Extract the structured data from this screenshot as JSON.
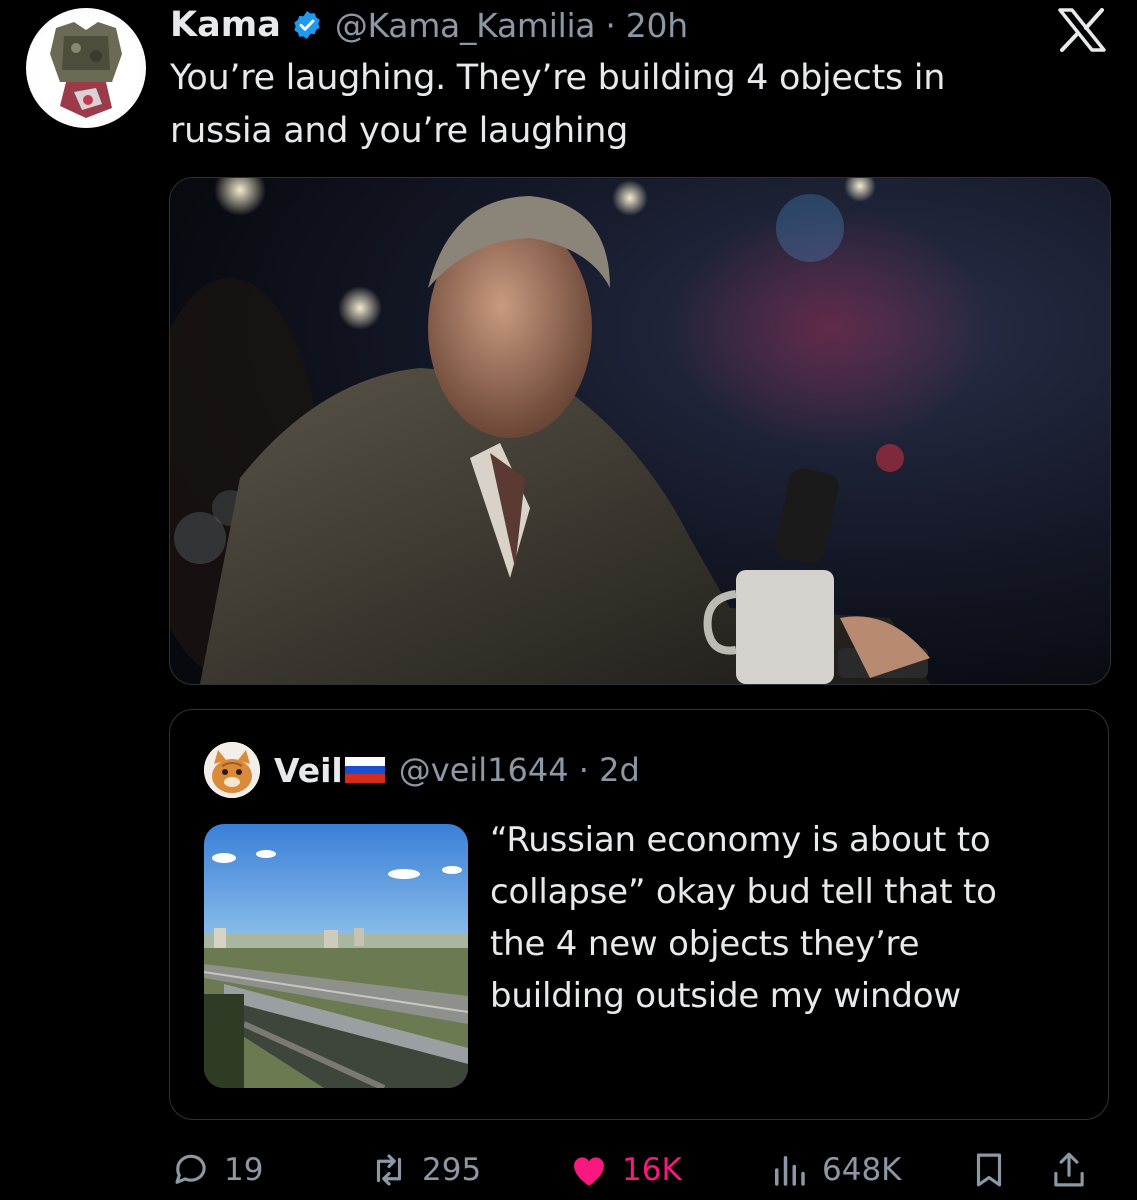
{
  "author": {
    "name": "Kama",
    "handle_time": "@Kama_Kamilia · 20h",
    "verified": true,
    "badge_color": "#1d9bf0"
  },
  "tweet": {
    "text_line1": "You’re laughing. They’re building 4 objects in",
    "text_line2": "russia and you’re laughing"
  },
  "quoted": {
    "name": "Veil",
    "handle_time": "@veil1644 · 2d",
    "lines": [
      "“Russian economy is about to",
      "collapse” okay bud tell that to",
      "the 4 new objects they’re",
      "building outside my window"
    ]
  },
  "actions": {
    "replies": "19",
    "retweets": "295",
    "likes": "16K",
    "views": "648K"
  },
  "colors": {
    "background": "#000000",
    "text": "#e7e9ea",
    "secondary": "#8b98a5",
    "like": "#f91880",
    "border": "#2f3336"
  },
  "icons": [
    "x-logo-icon",
    "verified-badge-icon",
    "reply-icon",
    "retweet-icon",
    "like-icon",
    "views-icon",
    "bookmark-icon",
    "share-icon"
  ]
}
